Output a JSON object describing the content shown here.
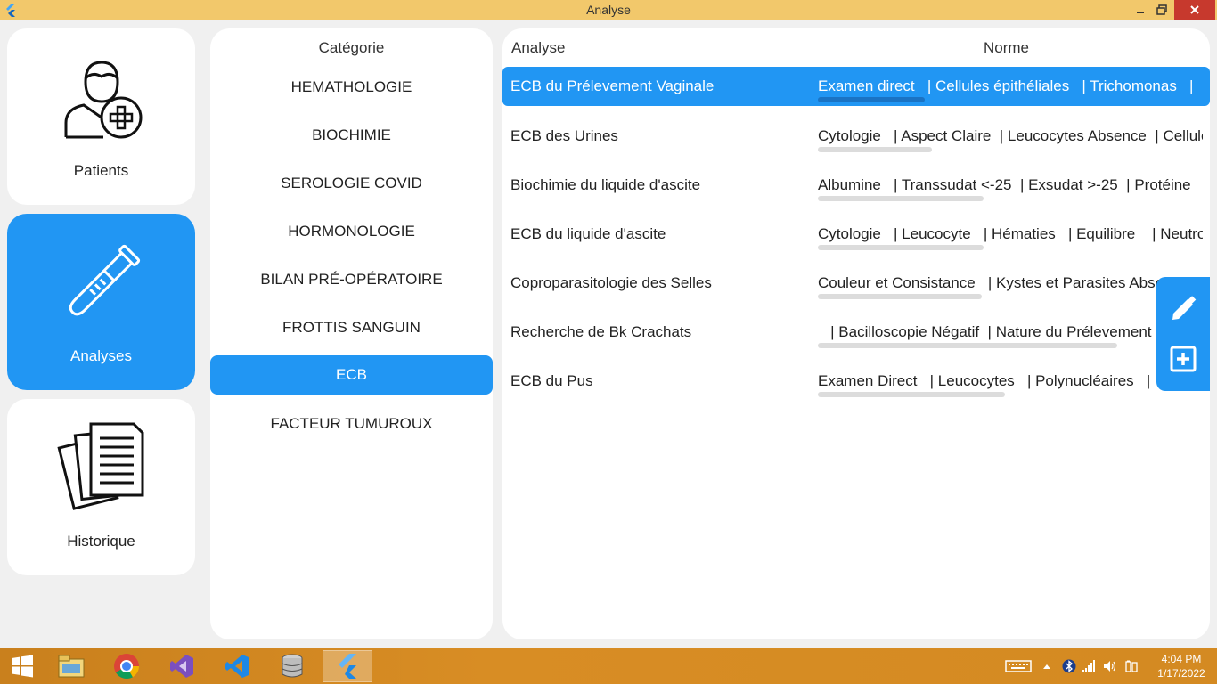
{
  "window": {
    "title": "Analyse"
  },
  "nav": {
    "items": [
      {
        "label": "Patients",
        "icon": "patient-add-icon"
      },
      {
        "label": "Analyses",
        "icon": "test-tube-icon"
      },
      {
        "label": "Historique",
        "icon": "documents-icon"
      }
    ],
    "active": "Analyses"
  },
  "categories": {
    "header": "Catégorie",
    "items": [
      "HEMATHOLOGIE",
      "BIOCHIMIE",
      "SEROLOGIE COVID",
      "HORMONOLOGIE",
      "BILAN PRÉ-OPÉRATOIRE",
      "FROTTIS SANGUIN",
      "ECB",
      "FACTEUR TUMUROUX"
    ],
    "selected": "ECB"
  },
  "analyses": {
    "header_analyse": "Analyse",
    "header_norme": "Norme",
    "rows": [
      {
        "name": "ECB du Prélevement Vaginale",
        "norme": "Examen direct   | Cellules épithéliales   | Trichomonas   |"
      },
      {
        "name": "ECB des Urines",
        "norme": "Cytologie   | Aspect Claire  | Leucocytes Absence  | Cellules"
      },
      {
        "name": "Biochimie du liquide d'ascite",
        "norme": "Albumine   | Transsudat <-25  | Exsudat >-25  | Protéine"
      },
      {
        "name": "ECB du liquide d'ascite",
        "norme": "Cytologie   | Leucocyte   | Hématies   | Equilibre    | Neutrophiles"
      },
      {
        "name": "Coproparasitologie des Selles",
        "norme": "Couleur et Consistance   | Kystes et Parasites Absence"
      },
      {
        "name": "Recherche de Bk Crachats",
        "norme": "   | Bacilloscopie Négatif  | Nature du Prélevement"
      },
      {
        "name": "ECB du Pus",
        "norme": "Examen Direct   | Leucocytes   | Polynucléaires   |"
      }
    ],
    "selected": "ECB du Prélevement Vaginale"
  },
  "actions": {
    "edit_icon": "pencil-icon",
    "add_icon": "plus-square-icon"
  },
  "taskbar": {
    "apps": [
      "start-icon",
      "file-explorer-icon",
      "chrome-icon",
      "visual-studio-icon",
      "vscode-icon",
      "database-icon",
      "flutter-icon"
    ],
    "time": "4:04 PM",
    "date": "1/17/2022"
  },
  "colors": {
    "accent": "#2196f3",
    "titlebar": "#f2c86b",
    "taskbar": "#d48a22"
  }
}
